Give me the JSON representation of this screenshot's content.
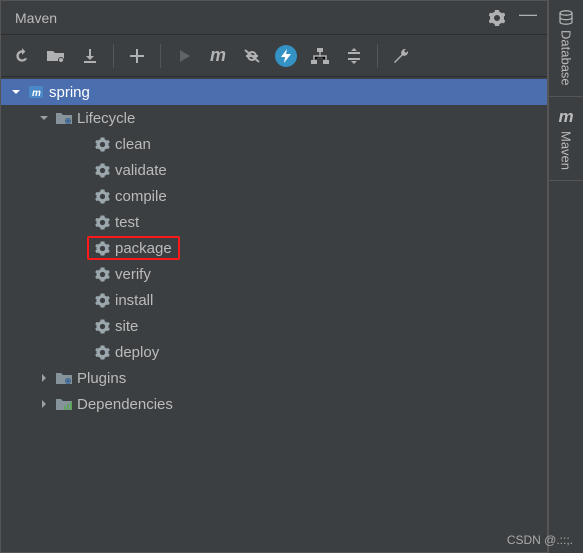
{
  "header": {
    "title": "Maven"
  },
  "toolbar": {
    "reload": "reload",
    "generate_sources": "generate",
    "download": "download",
    "add": "add",
    "run": "run",
    "m": "m",
    "skip_tests": "skip-tests",
    "offline": "offline",
    "show_deps": "deps",
    "collapse": "collapse",
    "settings": "settings"
  },
  "tree": {
    "root": {
      "label": "spring"
    },
    "lifecycle": {
      "label": "Lifecycle"
    },
    "phases": [
      {
        "key": "clean",
        "label": "clean",
        "highlighted": false
      },
      {
        "key": "validate",
        "label": "validate",
        "highlighted": false
      },
      {
        "key": "compile",
        "label": "compile",
        "highlighted": false
      },
      {
        "key": "test",
        "label": "test",
        "highlighted": false
      },
      {
        "key": "package",
        "label": "package",
        "highlighted": true
      },
      {
        "key": "verify",
        "label": "verify",
        "highlighted": false
      },
      {
        "key": "install",
        "label": "install",
        "highlighted": false
      },
      {
        "key": "site",
        "label": "site",
        "highlighted": false
      },
      {
        "key": "deploy",
        "label": "deploy",
        "highlighted": false
      }
    ],
    "plugins": {
      "label": "Plugins"
    },
    "dependencies": {
      "label": "Dependencies"
    }
  },
  "side_tabs": {
    "database": {
      "label": "Database"
    },
    "maven": {
      "label": "Maven"
    }
  },
  "watermark": "CSDN @.::;."
}
